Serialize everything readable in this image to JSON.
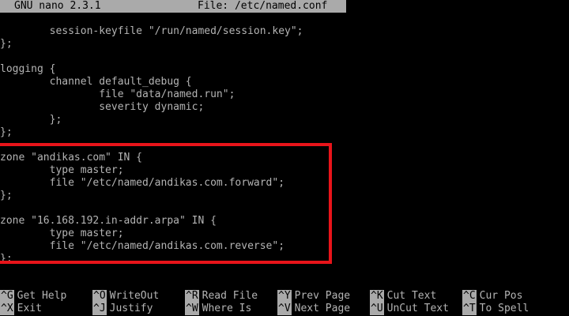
{
  "titlebar": {
    "app": "GNU nano 2.3.1",
    "file": "File: /etc/named.conf"
  },
  "editor": {
    "lines": [
      "        session-keyfile \"/run/named/session.key\";",
      "};",
      "",
      "logging {",
      "        channel default_debug {",
      "                file \"data/named.run\";",
      "                severity dynamic;",
      "        };",
      "};",
      "",
      "zone \"andikas.com\" IN {",
      "        type master;",
      "        file \"/etc/named/andikas.com.forward\";",
      "};",
      "",
      "zone \"16.168.192.in-addr.arpa\" IN {",
      "        type master;",
      "        file \"/etc/named/andikas.com.reverse\";",
      "};"
    ]
  },
  "shortcuts": {
    "row1": [
      {
        "key": "^G",
        "label": "Get Help"
      },
      {
        "key": "^O",
        "label": "WriteOut"
      },
      {
        "key": "^R",
        "label": "Read File"
      },
      {
        "key": "^Y",
        "label": "Prev Page"
      },
      {
        "key": "^K",
        "label": "Cut Text"
      },
      {
        "key": "^C",
        "label": "Cur Pos"
      }
    ],
    "row2": [
      {
        "key": "^X",
        "label": "Exit"
      },
      {
        "key": "^J",
        "label": "Justify"
      },
      {
        "key": "^W",
        "label": "Where Is"
      },
      {
        "key": "^V",
        "label": "Next Page"
      },
      {
        "key": "^U",
        "label": "UnCut Text"
      },
      {
        "key": "^T",
        "label": "To Spell"
      }
    ]
  },
  "colors": {
    "highlight": "#e8141a",
    "bar": "#aaaaaa",
    "background": "#000000"
  }
}
